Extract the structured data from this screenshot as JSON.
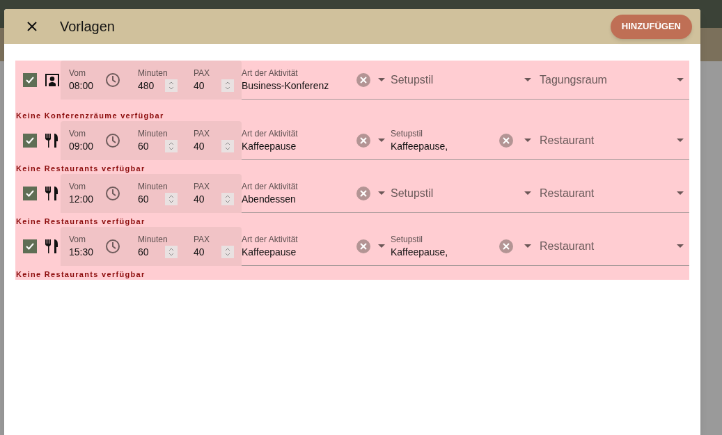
{
  "dialog": {
    "title": "Vorlagen",
    "add_button": "HINZUFÜGEN"
  },
  "rows": [
    {
      "checked": true,
      "kind": "presentation",
      "from_label": "Vom",
      "from": "08:00",
      "minutes_label": "Minuten",
      "minutes": "480",
      "pax_label": "PAX",
      "pax": "40",
      "activity_label": "Art der Aktivität",
      "activity": "Business-Konferenz",
      "setup_placeholder": "Setupstil",
      "room_placeholder": "Tagungsraum",
      "error": "Keine Konferenzräume verfügbar"
    },
    {
      "checked": true,
      "kind": "restaurant",
      "from_label": "Vom",
      "from": "09:00",
      "minutes_label": "Minuten",
      "minutes": "60",
      "pax_label": "PAX",
      "pax": "40",
      "activity_label": "Art der Aktivität",
      "activity": "Kaffeepause",
      "setup_label": "Setupstil",
      "setup": "Kaffeepause,",
      "room_placeholder": "Restaurant",
      "error": "Keine Restaurants verfügbar"
    },
    {
      "checked": true,
      "kind": "restaurant",
      "from_label": "Vom",
      "from": "12:00",
      "minutes_label": "Minuten",
      "minutes": "60",
      "pax_label": "PAX",
      "pax": "40",
      "activity_label": "Art der Aktivität",
      "activity": "Abendessen",
      "setup_placeholder": "Setupstil",
      "room_placeholder": "Restaurant",
      "error": "Keine Restaurants verfügbar"
    },
    {
      "checked": true,
      "kind": "restaurant",
      "from_label": "Vom",
      "from": "15:30",
      "minutes_label": "Minuten",
      "minutes": "60",
      "pax_label": "PAX",
      "pax": "40",
      "activity_label": "Art der Aktivität",
      "activity": "Kaffeepause",
      "setup_label": "Setupstil",
      "setup": "Kaffeepause,",
      "room_placeholder": "Restaurant",
      "error": "Keine Restaurants verfügbar"
    }
  ]
}
